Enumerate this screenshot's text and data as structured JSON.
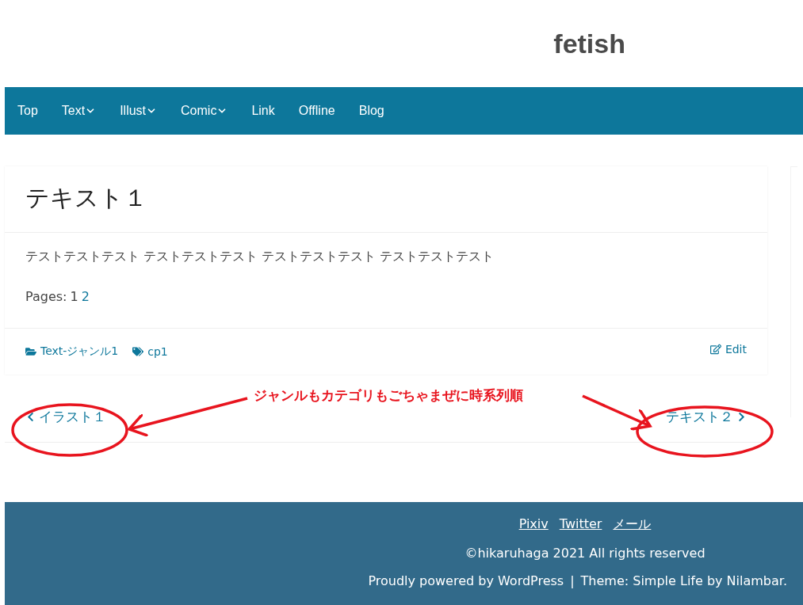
{
  "site_title": "fetish",
  "nav": [
    {
      "label": "Top",
      "dropdown": false
    },
    {
      "label": "Text",
      "dropdown": true
    },
    {
      "label": "Illust",
      "dropdown": true
    },
    {
      "label": "Comic",
      "dropdown": true
    },
    {
      "label": "Link",
      "dropdown": false
    },
    {
      "label": "Offline",
      "dropdown": false
    },
    {
      "label": "Blog",
      "dropdown": false
    }
  ],
  "post": {
    "title": "テキスト１",
    "body": "テストテストテスト テストテストテスト テストテストテスト テストテストテスト",
    "pages_label": "Pages:",
    "pages": [
      {
        "label": "1",
        "selected": true
      },
      {
        "label": "2",
        "selected": false
      }
    ],
    "category": "Text-ジャンル1",
    "tag": "cp1",
    "edit": "Edit"
  },
  "post_nav": {
    "previous": "イラスト１",
    "next": "テキスト２"
  },
  "annotation": {
    "text": "ジャンルもカテゴリもごちゃまぜに時系列順"
  },
  "footer": {
    "links": [
      "Pixiv",
      "Twitter",
      "メール"
    ],
    "copyright": "©hikaruhaga 2021 All rights reserved",
    "credit_prefix": "Proudly powered by WordPress",
    "separator": "|",
    "credit_suffix": "Theme: Simple Life by Nilambar."
  }
}
